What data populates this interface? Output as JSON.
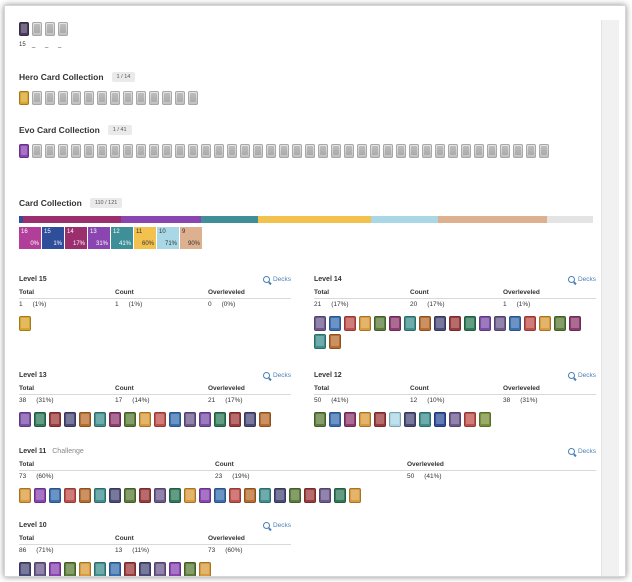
{
  "top": {
    "count_label": "15",
    "dashes": [
      "_",
      "_",
      "_"
    ]
  },
  "hero": {
    "title": "Hero Card Collection",
    "badge": "1 / 14"
  },
  "evo": {
    "title": "Evo Card Collection",
    "badge": "1 / 41"
  },
  "collection": {
    "title": "Card Collection",
    "badge": "110 / 121",
    "rarities": [
      {
        "level": "16",
        "percent": "0%",
        "color": "#b13f9a"
      },
      {
        "level": "15",
        "percent": "1%",
        "color": "#2f4e9a"
      },
      {
        "level": "14",
        "percent": "17%",
        "color": "#9b2f6e"
      },
      {
        "level": "13",
        "percent": "31%",
        "color": "#8a45b0"
      },
      {
        "level": "12",
        "percent": "41%",
        "color": "#3e8f97"
      },
      {
        "level": "11",
        "percent": "60%",
        "color": "#f2c14e"
      },
      {
        "level": "10",
        "percent": "71%",
        "color": "#a9d7e6"
      },
      {
        "level": "9",
        "percent": "90%",
        "color": "#ddb08f"
      }
    ]
  },
  "labels": {
    "total": "Total",
    "count": "Count",
    "overleveled": "Overleveled",
    "decks": "Decks"
  },
  "levels": [
    {
      "title": "Level 15",
      "subtitle": "",
      "total": "1",
      "total_pct": "(1%)",
      "count": "1",
      "count_pct": "(1%)",
      "over": "0",
      "over_pct": "(0%)"
    },
    {
      "title": "Level 14",
      "subtitle": "",
      "total": "21",
      "total_pct": "(17%)",
      "count": "20",
      "count_pct": "(17%)",
      "over": "1",
      "over_pct": "(1%)"
    },
    {
      "title": "Level 13",
      "subtitle": "",
      "total": "38",
      "total_pct": "(31%)",
      "count": "17",
      "count_pct": "(14%)",
      "over": "21",
      "over_pct": "(17%)"
    },
    {
      "title": "Level 12",
      "subtitle": "",
      "total": "50",
      "total_pct": "(41%)",
      "count": "12",
      "count_pct": "(10%)",
      "over": "38",
      "over_pct": "(31%)"
    },
    {
      "title": "Level 11",
      "subtitle": "Challenge",
      "total": "73",
      "total_pct": "(60%)",
      "count": "23",
      "count_pct": "(19%)",
      "over": "50",
      "over_pct": "(41%)"
    },
    {
      "title": "Level 10",
      "subtitle": "",
      "total": "86",
      "total_pct": "(71%)",
      "count": "13",
      "count_pct": "(11%)",
      "over": "73",
      "over_pct": "(60%)"
    }
  ]
}
